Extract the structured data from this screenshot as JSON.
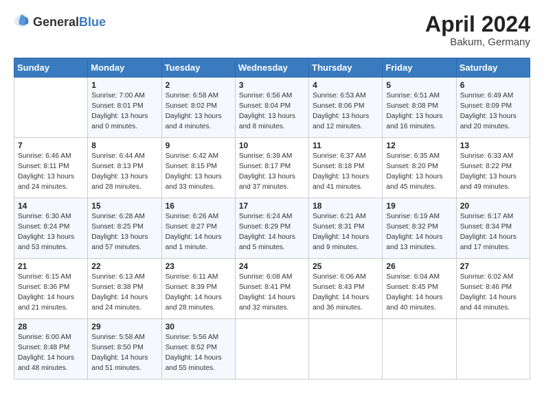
{
  "header": {
    "logo_general": "General",
    "logo_blue": "Blue",
    "month_title": "April 2024",
    "location": "Bakum, Germany"
  },
  "days_of_week": [
    "Sunday",
    "Monday",
    "Tuesday",
    "Wednesday",
    "Thursday",
    "Friday",
    "Saturday"
  ],
  "weeks": [
    [
      {
        "day": "",
        "sunrise": "",
        "sunset": "",
        "daylight": ""
      },
      {
        "day": "1",
        "sunrise": "Sunrise: 7:00 AM",
        "sunset": "Sunset: 8:01 PM",
        "daylight": "Daylight: 13 hours and 0 minutes."
      },
      {
        "day": "2",
        "sunrise": "Sunrise: 6:58 AM",
        "sunset": "Sunset: 8:02 PM",
        "daylight": "Daylight: 13 hours and 4 minutes."
      },
      {
        "day": "3",
        "sunrise": "Sunrise: 6:56 AM",
        "sunset": "Sunset: 8:04 PM",
        "daylight": "Daylight: 13 hours and 8 minutes."
      },
      {
        "day": "4",
        "sunrise": "Sunrise: 6:53 AM",
        "sunset": "Sunset: 8:06 PM",
        "daylight": "Daylight: 13 hours and 12 minutes."
      },
      {
        "day": "5",
        "sunrise": "Sunrise: 6:51 AM",
        "sunset": "Sunset: 8:08 PM",
        "daylight": "Daylight: 13 hours and 16 minutes."
      },
      {
        "day": "6",
        "sunrise": "Sunrise: 6:49 AM",
        "sunset": "Sunset: 8:09 PM",
        "daylight": "Daylight: 13 hours and 20 minutes."
      }
    ],
    [
      {
        "day": "7",
        "sunrise": "Sunrise: 6:46 AM",
        "sunset": "Sunset: 8:11 PM",
        "daylight": "Daylight: 13 hours and 24 minutes."
      },
      {
        "day": "8",
        "sunrise": "Sunrise: 6:44 AM",
        "sunset": "Sunset: 8:13 PM",
        "daylight": "Daylight: 13 hours and 28 minutes."
      },
      {
        "day": "9",
        "sunrise": "Sunrise: 6:42 AM",
        "sunset": "Sunset: 8:15 PM",
        "daylight": "Daylight: 13 hours and 33 minutes."
      },
      {
        "day": "10",
        "sunrise": "Sunrise: 6:39 AM",
        "sunset": "Sunset: 8:17 PM",
        "daylight": "Daylight: 13 hours and 37 minutes."
      },
      {
        "day": "11",
        "sunrise": "Sunrise: 6:37 AM",
        "sunset": "Sunset: 8:18 PM",
        "daylight": "Daylight: 13 hours and 41 minutes."
      },
      {
        "day": "12",
        "sunrise": "Sunrise: 6:35 AM",
        "sunset": "Sunset: 8:20 PM",
        "daylight": "Daylight: 13 hours and 45 minutes."
      },
      {
        "day": "13",
        "sunrise": "Sunrise: 6:33 AM",
        "sunset": "Sunset: 8:22 PM",
        "daylight": "Daylight: 13 hours and 49 minutes."
      }
    ],
    [
      {
        "day": "14",
        "sunrise": "Sunrise: 6:30 AM",
        "sunset": "Sunset: 8:24 PM",
        "daylight": "Daylight: 13 hours and 53 minutes."
      },
      {
        "day": "15",
        "sunrise": "Sunrise: 6:28 AM",
        "sunset": "Sunset: 8:25 PM",
        "daylight": "Daylight: 13 hours and 57 minutes."
      },
      {
        "day": "16",
        "sunrise": "Sunrise: 6:26 AM",
        "sunset": "Sunset: 8:27 PM",
        "daylight": "Daylight: 14 hours and 1 minute."
      },
      {
        "day": "17",
        "sunrise": "Sunrise: 6:24 AM",
        "sunset": "Sunset: 8:29 PM",
        "daylight": "Daylight: 14 hours and 5 minutes."
      },
      {
        "day": "18",
        "sunrise": "Sunrise: 6:21 AM",
        "sunset": "Sunset: 8:31 PM",
        "daylight": "Daylight: 14 hours and 9 minutes."
      },
      {
        "day": "19",
        "sunrise": "Sunrise: 6:19 AM",
        "sunset": "Sunset: 8:32 PM",
        "daylight": "Daylight: 14 hours and 13 minutes."
      },
      {
        "day": "20",
        "sunrise": "Sunrise: 6:17 AM",
        "sunset": "Sunset: 8:34 PM",
        "daylight": "Daylight: 14 hours and 17 minutes."
      }
    ],
    [
      {
        "day": "21",
        "sunrise": "Sunrise: 6:15 AM",
        "sunset": "Sunset: 8:36 PM",
        "daylight": "Daylight: 14 hours and 21 minutes."
      },
      {
        "day": "22",
        "sunrise": "Sunrise: 6:13 AM",
        "sunset": "Sunset: 8:38 PM",
        "daylight": "Daylight: 14 hours and 24 minutes."
      },
      {
        "day": "23",
        "sunrise": "Sunrise: 6:11 AM",
        "sunset": "Sunset: 8:39 PM",
        "daylight": "Daylight: 14 hours and 28 minutes."
      },
      {
        "day": "24",
        "sunrise": "Sunrise: 6:08 AM",
        "sunset": "Sunset: 8:41 PM",
        "daylight": "Daylight: 14 hours and 32 minutes."
      },
      {
        "day": "25",
        "sunrise": "Sunrise: 6:06 AM",
        "sunset": "Sunset: 8:43 PM",
        "daylight": "Daylight: 14 hours and 36 minutes."
      },
      {
        "day": "26",
        "sunrise": "Sunrise: 6:04 AM",
        "sunset": "Sunset: 8:45 PM",
        "daylight": "Daylight: 14 hours and 40 minutes."
      },
      {
        "day": "27",
        "sunrise": "Sunrise: 6:02 AM",
        "sunset": "Sunset: 8:46 PM",
        "daylight": "Daylight: 14 hours and 44 minutes."
      }
    ],
    [
      {
        "day": "28",
        "sunrise": "Sunrise: 6:00 AM",
        "sunset": "Sunset: 8:48 PM",
        "daylight": "Daylight: 14 hours and 48 minutes."
      },
      {
        "day": "29",
        "sunrise": "Sunrise: 5:58 AM",
        "sunset": "Sunset: 8:50 PM",
        "daylight": "Daylight: 14 hours and 51 minutes."
      },
      {
        "day": "30",
        "sunrise": "Sunrise: 5:56 AM",
        "sunset": "Sunset: 8:52 PM",
        "daylight": "Daylight: 14 hours and 55 minutes."
      },
      {
        "day": "",
        "sunrise": "",
        "sunset": "",
        "daylight": ""
      },
      {
        "day": "",
        "sunrise": "",
        "sunset": "",
        "daylight": ""
      },
      {
        "day": "",
        "sunrise": "",
        "sunset": "",
        "daylight": ""
      },
      {
        "day": "",
        "sunrise": "",
        "sunset": "",
        "daylight": ""
      }
    ]
  ]
}
